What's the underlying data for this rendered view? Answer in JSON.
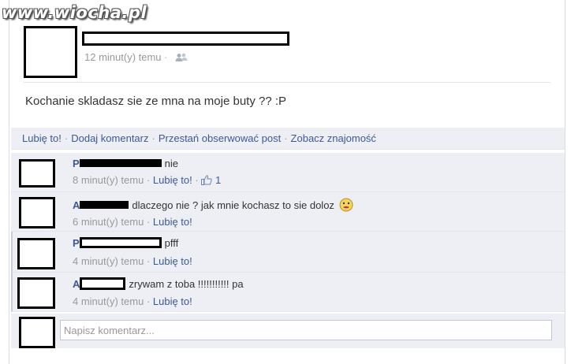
{
  "watermark": "www.wiocha.pl",
  "post": {
    "timestamp": "12 minut(y) temu",
    "privacy_icon": "friends-icon",
    "message": "Kochanie skladasz sie ze mna na moje buty ?? :P"
  },
  "actions": {
    "like": "Lubię to!",
    "comment": "Dodaj komentarz",
    "unfollow": "Przestań obserwować post",
    "see_friendship": "Zobacz znajomość"
  },
  "comments": [
    {
      "initial": "P",
      "text": "nie",
      "time": "8 minut(y) temu",
      "like": "Lubię to!",
      "likes_count": "1"
    },
    {
      "initial": "A",
      "text": "dlaczego nie ? jak mnie kochasz to sie doloz",
      "time": "6 minut(y) temu",
      "like": "Lubię to!",
      "emoji": "sick-face-icon"
    },
    {
      "initial": "P",
      "text": "pfff",
      "time": "4 minut(y) temu",
      "like": "Lubię to!"
    },
    {
      "initial": "A",
      "text": "zrywam z toba !!!!!!!!!!! pa",
      "time": "4 minut(y) temu",
      "like": "Lubię to!"
    }
  ],
  "composer": {
    "placeholder": "Napisz komentarz..."
  },
  "colors": {
    "link": "#3b5998",
    "panel": "#edeff4",
    "muted": "#999999"
  }
}
